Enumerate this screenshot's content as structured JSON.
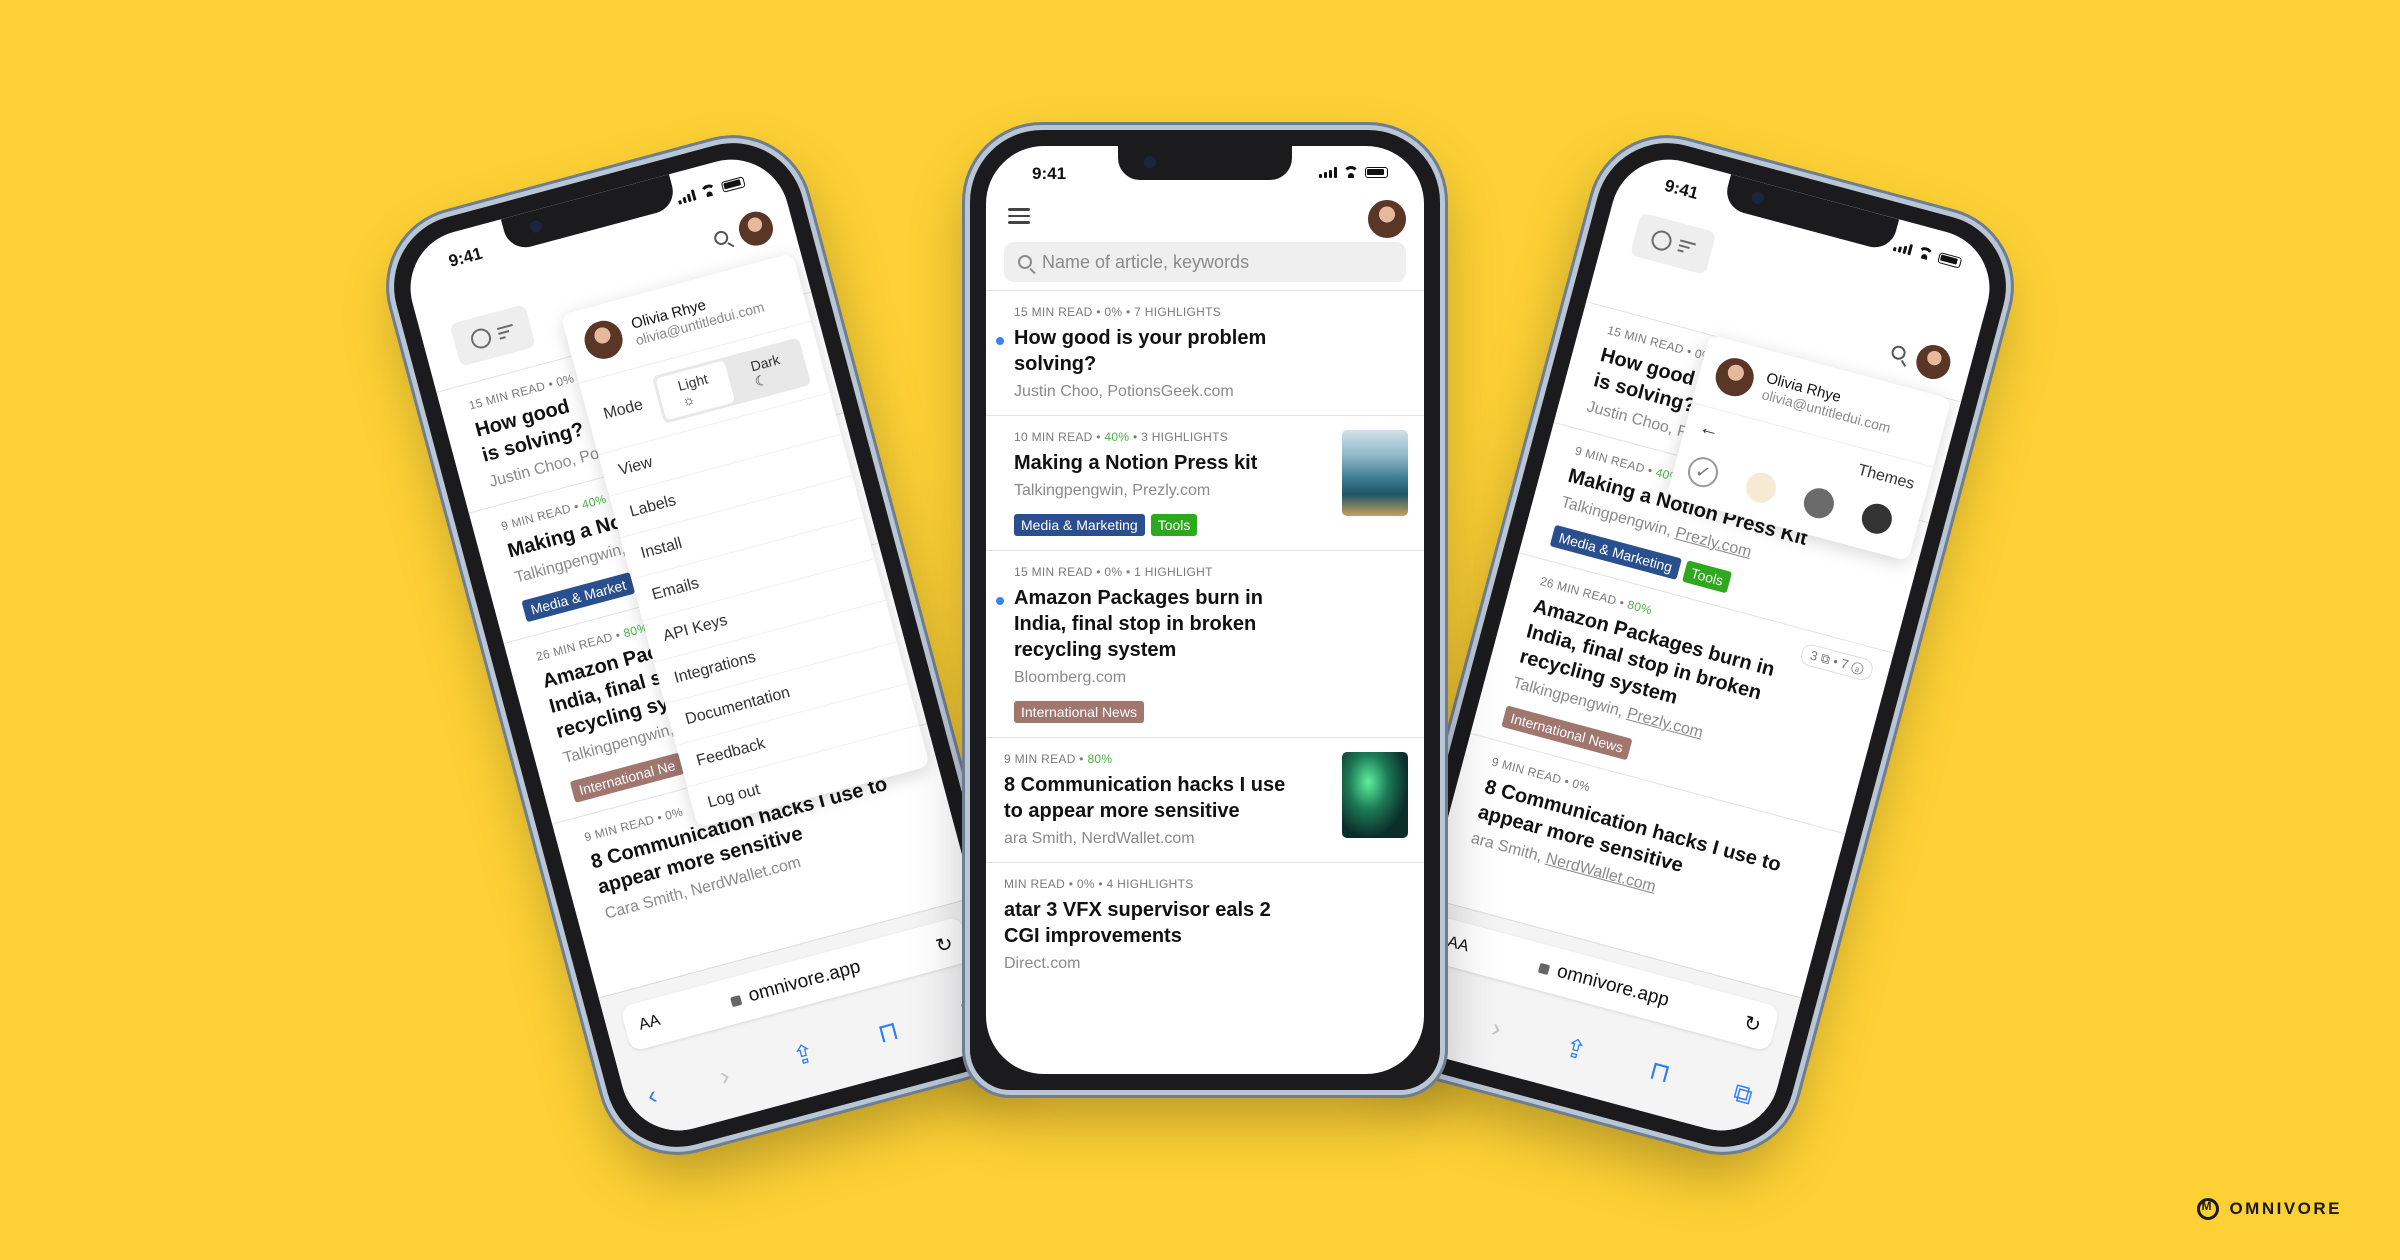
{
  "status_time": "9:41",
  "search": {
    "placeholder": "Name of article, keywords"
  },
  "url": "omnivore.app",
  "url_aa": "AA",
  "articles": [
    {
      "meta": "15 MIN READ • 0% • 7 HIGHLIGHTS",
      "title": "How good is your problem solving?",
      "source": "Justin Choo, PotionsGeek.com"
    },
    {
      "meta_pre": "10 MIN READ • ",
      "meta_pct": "40%",
      "meta_post": " • 3 HIGHLIGHTS",
      "title": "Making a Notion Press kit",
      "source": "Talkingpengwin, Prezly.com",
      "tags": [
        "Media & Marketing",
        "Tools"
      ]
    },
    {
      "meta": "15 MIN READ • 0% • 1 HIGHLIGHT",
      "title": "Amazon Packages burn in India, final stop in broken recycling system",
      "source": "Bloomberg.com",
      "tags": [
        "International News"
      ]
    },
    {
      "meta_pre": "9 MIN READ • ",
      "meta_pct": "80%",
      "title": "8 Communication hacks I use to appear more sensitive",
      "source": "ara Smith, NerdWallet.com"
    },
    {
      "meta": "MIN READ • 0% • 4 HIGHLIGHTS",
      "title": "atar 3 VFX supervisor eals 2 CGI improvements",
      "source": "Direct.com"
    }
  ],
  "left_phone": {
    "articles": [
      {
        "meta": "15 MIN READ • 0%",
        "title": "How good is solving?",
        "source": "Justin Choo, Poti"
      },
      {
        "meta_pre": "9 MIN READ • ",
        "meta_pct": "40%",
        "title": "Making a No",
        "source": "Talkingpengwin,",
        "tag": "Media & Market"
      },
      {
        "meta_pre": "26 MIN READ • ",
        "meta_pct": "80%",
        "title": "Amazon Pac India, final s recycling sy",
        "source": "Talkingpengwin,",
        "tag": "International Ne"
      },
      {
        "meta": "9 MIN READ • 0%",
        "title": "8 Communication hacks I use to appear more sensitive",
        "source": "Cara Smith, NerdWallet.com"
      }
    ],
    "menu": {
      "name": "Olivia Rhye",
      "email": "olivia@untitledui.com",
      "mode_label": "Mode",
      "light": "Light",
      "dark": "Dark",
      "items": [
        "View",
        "Labels",
        "Install",
        "Emails",
        "API Keys",
        "Integrations",
        "Documentation",
        "Feedback",
        "Log out"
      ]
    }
  },
  "right_phone": {
    "articles": [
      {
        "meta": "15 MIN READ • 0%",
        "title": "How good is solving?",
        "source": "Justin Choo, Poti"
      },
      {
        "meta_pre": "9 MIN READ • ",
        "meta_pct": "40%",
        "title": "Making a Notion Press Kit",
        "source": "Talkingpengwin,",
        "source_link": "Prezly.com",
        "tags": [
          "Media & Marketing",
          "Tools"
        ]
      },
      {
        "meta_pre": "26 MIN READ • ",
        "meta_pct": "80%",
        "title": "Amazon Packages burn in India, final stop in broken recycling system",
        "source": "Talkingpengwin,",
        "source_link": "Prezly.com",
        "tags": [
          "International News"
        ],
        "counts": "3 ⧉ • 7 ⓐ"
      },
      {
        "meta": "9 MIN READ • 0%",
        "title": "8 Communication hacks I use to appear more sensitive",
        "source": "ara Smith,",
        "source_link": "NerdWallet.com"
      }
    ],
    "menu": {
      "name": "Olivia Rhye",
      "email": "olivia@untitledui.com",
      "back": "←",
      "themes_label": "Themes",
      "check": "✓"
    }
  },
  "brand": "OMNIVORE",
  "colors": {
    "background": "#FDD135",
    "tag_media": "#2a4f8e",
    "tag_tools": "#2ea81c",
    "tag_intl": "#a0766f",
    "progress": "#47b53f",
    "link": "#2f7cf6",
    "theme_swatches": [
      "#ffffff",
      "#f6ead5",
      "#6b6b6b",
      "#333333"
    ]
  }
}
